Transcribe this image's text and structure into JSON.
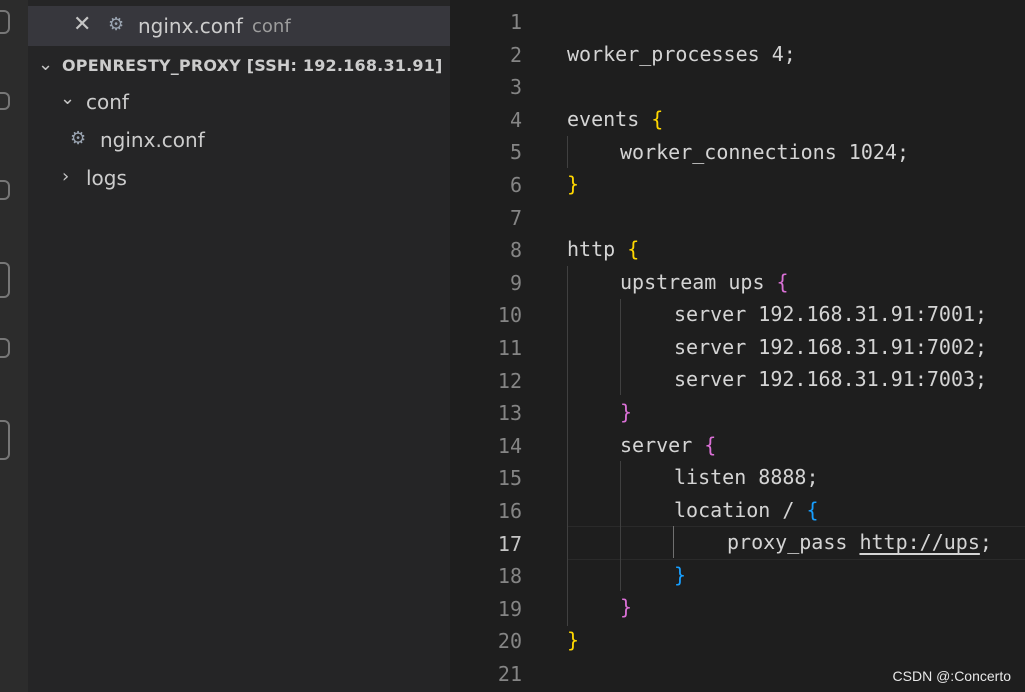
{
  "sidebar": {
    "open_editor": {
      "name": "nginx.conf",
      "description": "conf"
    },
    "folder_title": "OPENRESTY_PROXY [SSH: 192.168.31.91]",
    "tree": {
      "conf_folder": "conf",
      "nginx_file": "nginx.conf",
      "logs_folder": "logs"
    }
  },
  "editor": {
    "active_line": 17,
    "lines": [
      {
        "n": "1"
      },
      {
        "n": "2"
      },
      {
        "n": "3"
      },
      {
        "n": "4"
      },
      {
        "n": "5"
      },
      {
        "n": "6"
      },
      {
        "n": "7"
      },
      {
        "n": "8"
      },
      {
        "n": "9"
      },
      {
        "n": "10"
      },
      {
        "n": "11"
      },
      {
        "n": "12"
      },
      {
        "n": "13"
      },
      {
        "n": "14"
      },
      {
        "n": "15"
      },
      {
        "n": "16"
      },
      {
        "n": "17"
      },
      {
        "n": "18"
      },
      {
        "n": "19"
      },
      {
        "n": "20"
      },
      {
        "n": "21"
      }
    ],
    "code": {
      "l2": "worker_processes 4;",
      "l4": "events ",
      "l5": "worker_connections 1024;",
      "l8": "http ",
      "l9": "upstream ups ",
      "l10": "server 192.168.31.91:7001;",
      "l11": "server 192.168.31.91:7002;",
      "l12": "server 192.168.31.91:7003;",
      "l14": "server ",
      "l15": "listen 8888;",
      "l16": "location / ",
      "l17_kw": "proxy_pass ",
      "l17_url": "http://ups",
      "l17_end": ";"
    },
    "brackets": {
      "open": "{",
      "close": "}"
    }
  },
  "watermark": "CSDN @:Concerto",
  "colors": {
    "bracket_level1": "#ffd700",
    "bracket_level2": "#da70d6",
    "bracket_level3": "#179fff"
  }
}
